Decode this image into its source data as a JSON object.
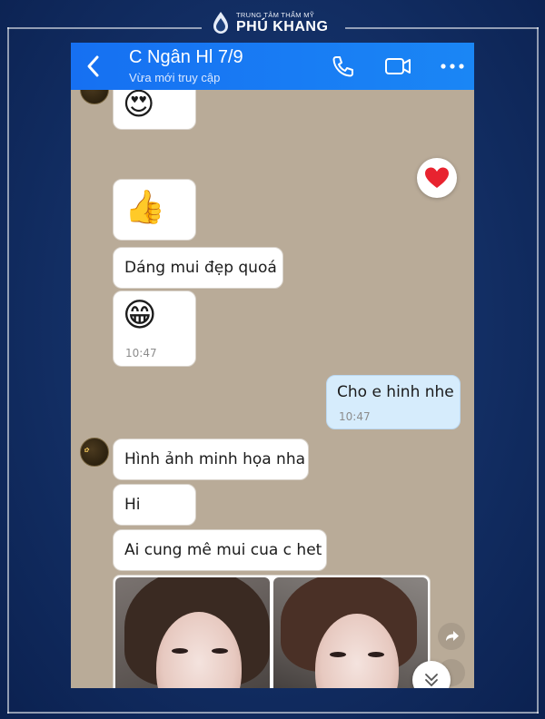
{
  "brand": {
    "small_text": "TRUNG TÂM THẨM MỸ",
    "name": "PHÚ KHANG"
  },
  "header": {
    "title": "C Ngân Hl 7/9",
    "status": "Vừa mới truy cập",
    "icons": [
      "back-arrow-icon",
      "phone-icon",
      "video-call-icon",
      "more-options-icon"
    ]
  },
  "messages": [
    {
      "from": "other",
      "type": "sticker",
      "emoji": "😍"
    },
    {
      "from": "other",
      "type": "sticker",
      "emoji": "👍"
    },
    {
      "from": "other",
      "type": "text",
      "text": "Dáng mui đẹp quoá"
    },
    {
      "from": "other",
      "type": "sticker",
      "emoji": "😁",
      "time": "10:47"
    },
    {
      "from": "me",
      "type": "text",
      "text": "Cho e hinh nhe",
      "time": "10:47"
    },
    {
      "from": "other",
      "type": "text",
      "text": "Hình ảnh minh họa nha"
    },
    {
      "from": "other",
      "type": "text",
      "text": "Hi"
    },
    {
      "from": "other",
      "type": "text",
      "text": "Ai cung mê mui cua c het"
    },
    {
      "from": "other",
      "type": "photos",
      "count": 2
    }
  ],
  "reaction": {
    "emoji": "❤️"
  },
  "controls": {
    "share_icon": "share-icon",
    "scroll_down_icon": "chevron-double-down-icon"
  },
  "colors": {
    "header": "#1a7cf4",
    "chat_bg": "#b9ab98",
    "my_bubble": "#d6ecfc",
    "frame": "#143168"
  }
}
